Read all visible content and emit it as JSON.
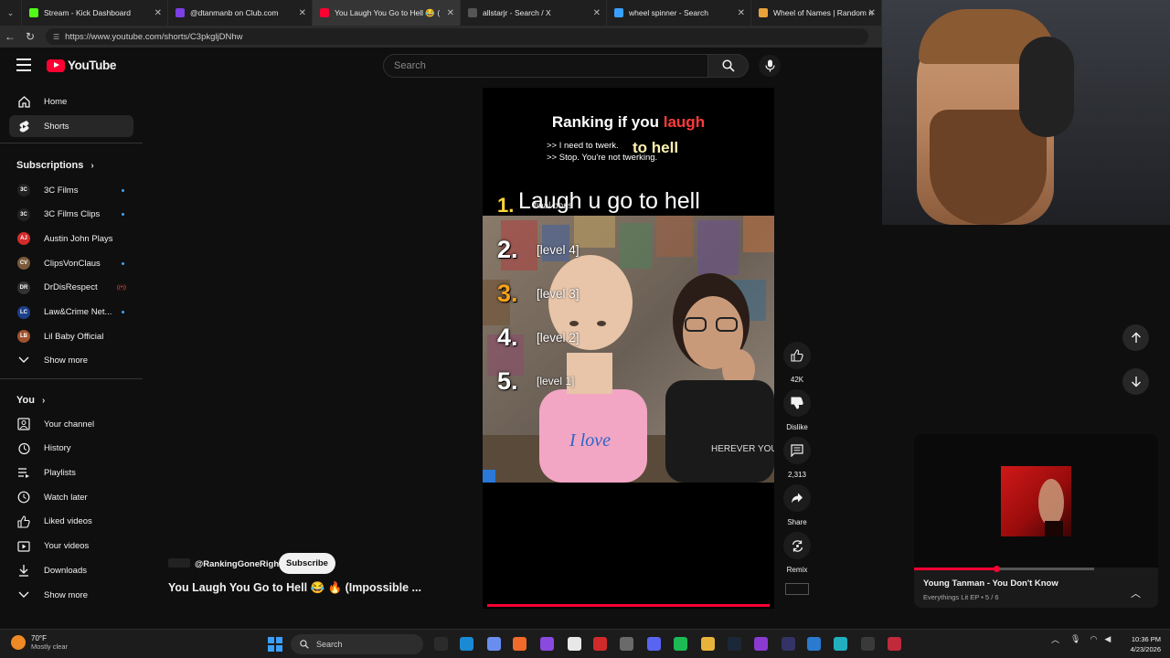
{
  "browser": {
    "tabs": [
      {
        "title": "Stream - Kick Dashboard",
        "color": "#53fc18",
        "active": false
      },
      {
        "title": "@dtanmanb on Club.com",
        "color": "#7b3fe4",
        "active": false
      },
      {
        "title": "You Laugh You Go to Hell 😂 (",
        "color": "#ff0033",
        "active": true
      },
      {
        "title": "allstarjr - Search / X",
        "color": "#555555",
        "active": false
      },
      {
        "title": "wheel spinner - Search",
        "color": "#3aa0ff",
        "active": false
      },
      {
        "title": "Wheel of Names | Random name",
        "color": "#e8a23a",
        "active": false
      }
    ],
    "url": "https://www.youtube.com/shorts/C3pkgljDNhw"
  },
  "youtube": {
    "logo_text": "YouTube",
    "search_placeholder": "Search"
  },
  "sidebar": {
    "main": [
      {
        "label": "Home",
        "icon": "home-icon",
        "active": false
      },
      {
        "label": "Shorts",
        "icon": "shorts-icon",
        "active": true
      }
    ],
    "subscriptions_heading": "Subscriptions",
    "subscriptions": [
      {
        "label": "3C Films",
        "avatar": "3C",
        "color": "#222222",
        "indicator": "dot"
      },
      {
        "label": "3C Films Clips",
        "avatar": "3C",
        "color": "#222222",
        "indicator": "dot"
      },
      {
        "label": "Austin John Plays",
        "avatar": "AJ",
        "color": "#d22b2b",
        "indicator": ""
      },
      {
        "label": "ClipsVonClaus",
        "avatar": "CV",
        "color": "#7a5a3a",
        "indicator": "dot"
      },
      {
        "label": "DrDisRespect",
        "avatar": "DR",
        "color": "#333333",
        "indicator": "live"
      },
      {
        "label": "Law&Crime Net...",
        "avatar": "LC",
        "color": "#1c3f8a",
        "indicator": "dot"
      },
      {
        "label": "Lil Baby Official",
        "avatar": "LB",
        "color": "#a0522d",
        "indicator": ""
      }
    ],
    "show_more_1": "Show more",
    "you_heading": "You",
    "you": [
      {
        "label": "Your channel",
        "icon": "channel-icon"
      },
      {
        "label": "History",
        "icon": "history-icon"
      },
      {
        "label": "Playlists",
        "icon": "playlists-icon"
      },
      {
        "label": "Watch later",
        "icon": "watch-later-icon"
      },
      {
        "label": "Liked videos",
        "icon": "liked-icon"
      },
      {
        "label": "Your videos",
        "icon": "your-videos-icon"
      },
      {
        "label": "Downloads",
        "icon": "downloads-icon"
      }
    ],
    "show_more_2": "Show more"
  },
  "short": {
    "title_part1": "Ranking if you ",
    "title_part2": "laugh",
    "title_line2": "to hell",
    "caption1": ">> I need to twerk.",
    "caption2": ">> Stop. You're not twerking.",
    "rank1_text": "Laugh u go to hell",
    "rank1_overlay": "final boss",
    "ranks": [
      {
        "num": "1.",
        "style": "gold"
      },
      {
        "num": "2.",
        "style": "white"
      },
      {
        "num": "3.",
        "style": "orange"
      },
      {
        "num": "4.",
        "style": "white"
      },
      {
        "num": "5.",
        "style": "white"
      }
    ],
    "levels": [
      "[level 4]",
      "[level 3]",
      "[level 2]",
      "[level 1]"
    ],
    "shirt_text": "I love",
    "shirt_text2": "HEREVER YOU"
  },
  "actions": {
    "likes": "42K",
    "dislike": "Dislike",
    "comments": "2,313",
    "share": "Share",
    "remix": "Remix"
  },
  "video_info": {
    "channel": "@RankingGoneRight",
    "subscribe": "Subscribe",
    "title": "You Laugh You Go to Hell 😂 🔥 (Impossible ..."
  },
  "miniplayer": {
    "title": "Young Tanman - You Don't Know",
    "subtitle": "Everythings Lit EP • 5 / 6",
    "progress": 0.46
  },
  "taskbar": {
    "temp": "70°F",
    "weather": "Mostly clear",
    "search": "Search",
    "time": "10:36 PM",
    "date": "4/23/2026"
  }
}
